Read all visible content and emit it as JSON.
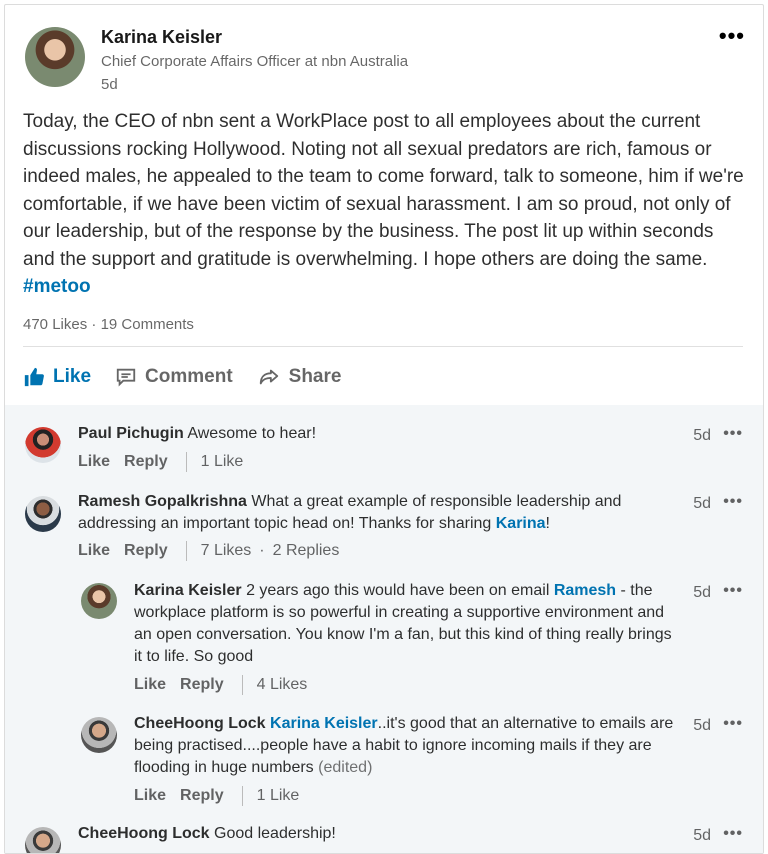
{
  "post": {
    "author_name": "Karina Keisler",
    "author_headline": "Chief Corporate Affairs Officer at nbn Australia",
    "time": "5d",
    "more": "•••",
    "text": "Today, the CEO of nbn sent a WorkPlace post to all employees about the current discussions rocking Hollywood. Noting not all sexual predators are rich, famous or indeed males, he appealed to the team to come forward, talk to someone, him if we're comfortable, if we have been victim of sexual harassment. I am so proud, not only of our leadership, but of the response by the business. The post lit up within seconds and the support and gratitude is overwhelming. I hope others are doing the same.",
    "hashtag": "#metoo",
    "likes": "470 Likes",
    "separator": " · ",
    "comments_count": "19 Comments"
  },
  "actions": {
    "like": "Like",
    "comment": "Comment",
    "share": "Share"
  },
  "colors": {
    "accent": "#0073b1",
    "comments_bg": "#f3f6f8"
  },
  "comments": [
    {
      "name": "Paul Pichugin",
      "text": "Awesome to hear!",
      "time": "5d",
      "like": "Like",
      "reply": "Reply",
      "likes": "1 Like"
    },
    {
      "name": "Ramesh Gopalkrishna",
      "text": "What a great example of responsible leadership and addressing an important topic head on! Thanks for sharing",
      "mention": "Karina",
      "suffix": "!",
      "time": "5d",
      "like": "Like",
      "reply": "Reply",
      "likes": "7 Likes",
      "dot": "·",
      "replies": "2 Replies",
      "children": [
        {
          "name": "Karina Keisler",
          "text_before": "2 years ago this would have been on email",
          "mention": "Ramesh",
          "text_after": "- the workplace platform is so powerful in creating a supportive environment and an open conversation. You know I'm a fan, but this kind of thing really brings it to life. So good",
          "time": "5d",
          "like": "Like",
          "reply": "Reply",
          "likes": "4 Likes"
        },
        {
          "name": "CheeHoong Lock",
          "mention": "Karina Keisler",
          "text": "..it's good that an alternative to emails are being practised....people have a habit to ignore incoming mails if they are flooding in huge numbers",
          "edited": "(edited)",
          "time": "5d",
          "like": "Like",
          "reply": "Reply",
          "likes": "1 Like"
        }
      ]
    },
    {
      "name": "CheeHoong Lock",
      "text": "Good leadership!",
      "time": "5d"
    }
  ],
  "comment_more": "•••"
}
